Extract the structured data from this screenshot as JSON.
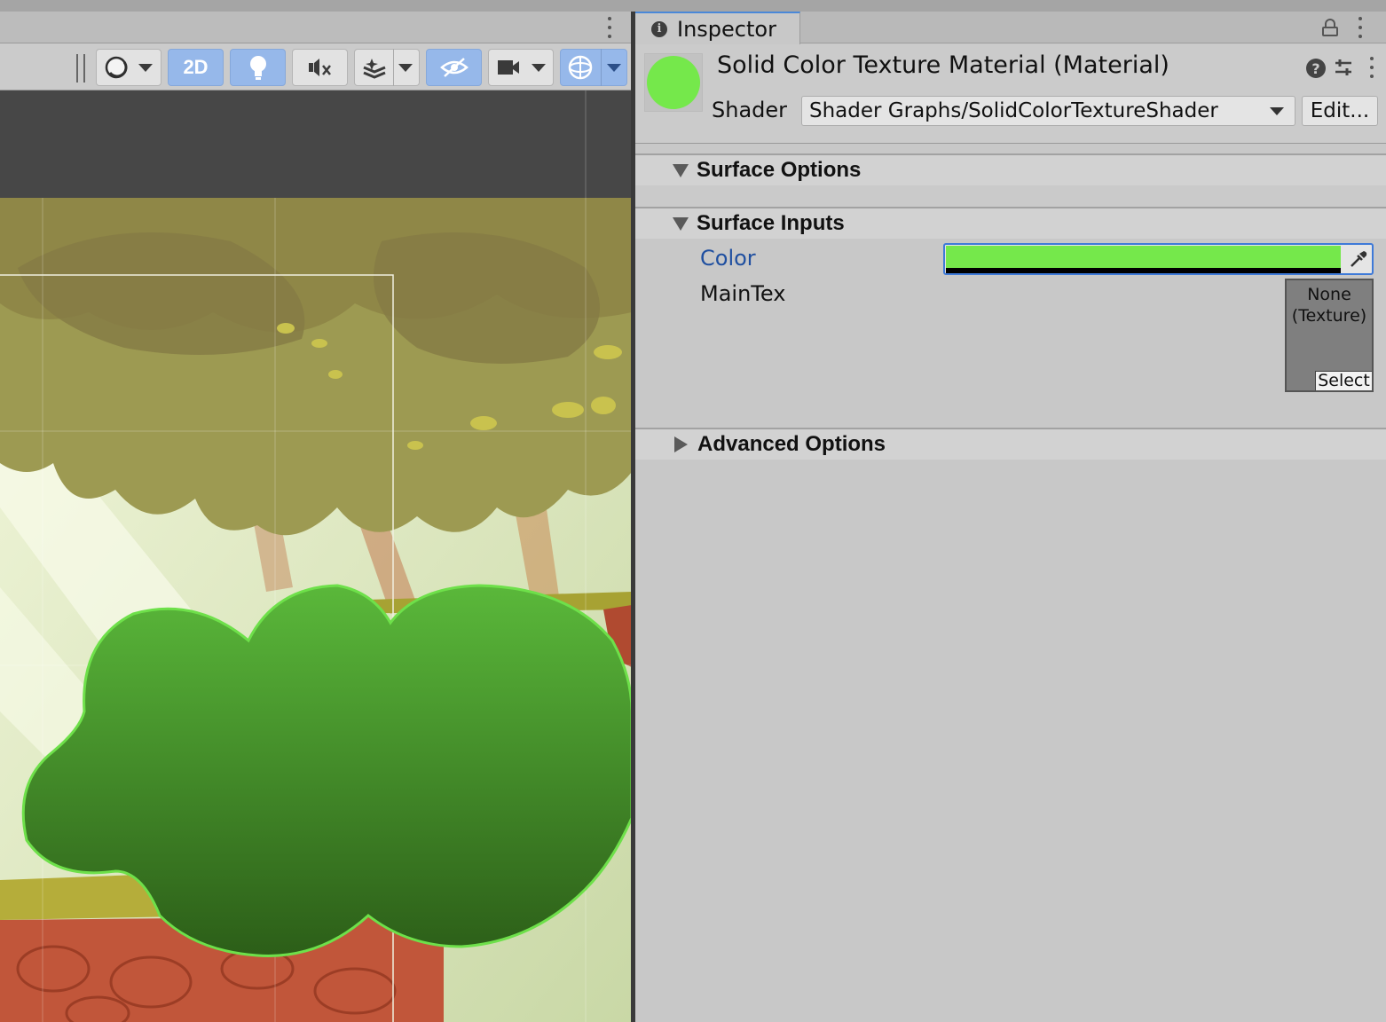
{
  "scene": {
    "toolbar": {
      "mode_2d_label": "2D"
    },
    "colors": {
      "bush_top": "#5ab83a",
      "bush_bottom": "#2c5e18",
      "sky": "#dfe8c2",
      "canopy": "#9d9a52",
      "ground": "#c1563a"
    }
  },
  "inspector": {
    "tab_label": "Inspector",
    "material_title": "Solid Color Texture Material (Material)",
    "shader_label": "Shader",
    "shader_value": "Shader Graphs/SolidColorTextureShader",
    "edit_button": "Edit...",
    "sections": {
      "surface_options": "Surface Options",
      "surface_inputs": "Surface Inputs",
      "advanced_options": "Advanced Options"
    },
    "properties": {
      "color_label": "Color",
      "color_value": "#75e84b",
      "maintex_label": "MainTex",
      "texture_none_line1": "None",
      "texture_none_line2": "(Texture)",
      "texture_select": "Select"
    }
  }
}
